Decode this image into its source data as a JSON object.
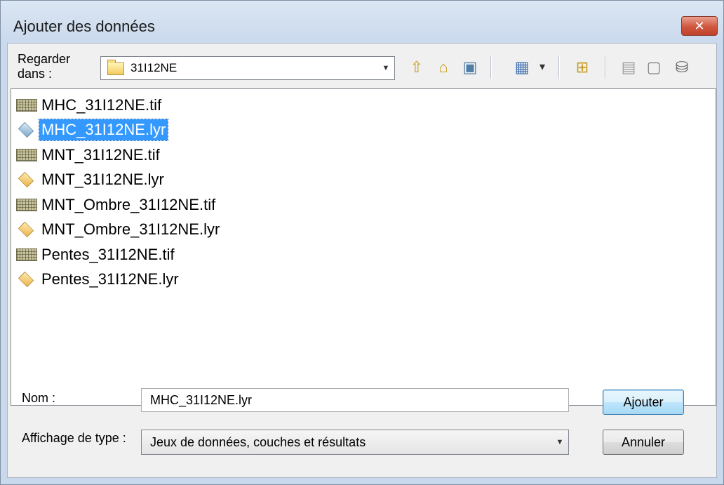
{
  "window": {
    "title": "Ajouter des données",
    "close_glyph": "✕"
  },
  "toolbar": {
    "look_in_label": "Regarder dans :",
    "look_in_value": "31I12NE",
    "buttons": [
      {
        "name": "up-one-level-icon",
        "glyph": "⇧",
        "color": "#c79a1b"
      },
      {
        "name": "home-icon",
        "glyph": "⌂",
        "color": "#c79a1b"
      },
      {
        "name": "catalog-connect-icon",
        "glyph": "▣",
        "color": "#4f7fa8"
      },
      {
        "name": "view-list-icon",
        "glyph": "▦",
        "color": "#3f6fb0"
      },
      {
        "name": "view-dropdown-icon",
        "glyph": "▾",
        "color": "#333333"
      },
      {
        "name": "new-folder-icon",
        "glyph": "⊞",
        "color": "#c79a1b"
      },
      {
        "name": "new-item-icon",
        "glyph": "▤",
        "color": "#9a9a9a"
      },
      {
        "name": "properties-icon",
        "glyph": "▢",
        "color": "#7f7f7f"
      },
      {
        "name": "connect-database-icon",
        "glyph": "⛁",
        "color": "#5f5f5f"
      }
    ]
  },
  "files": [
    {
      "name": "MHC_31I12NE.tif",
      "type": "raster",
      "selected": false
    },
    {
      "name": "MHC_31I12NE.lyr",
      "type": "layer-blue",
      "selected": true
    },
    {
      "name": "MNT_31I12NE.tif",
      "type": "raster",
      "selected": false
    },
    {
      "name": "MNT_31I12NE.lyr",
      "type": "layer",
      "selected": false
    },
    {
      "name": "MNT_Ombre_31I12NE.tif",
      "type": "raster",
      "selected": false
    },
    {
      "name": "MNT_Ombre_31I12NE.lyr",
      "type": "layer",
      "selected": false
    },
    {
      "name": "Pentes_31I12NE.tif",
      "type": "raster",
      "selected": false
    },
    {
      "name": "Pentes_31I12NE.lyr",
      "type": "layer",
      "selected": false
    }
  ],
  "form": {
    "name_label": "Nom :",
    "name_value": "MHC_31I12NE.lyr",
    "type_label": "Affichage de type :",
    "type_value": "Jeux de données, couches et résultats",
    "add_button": "Ajouter",
    "cancel_button": "Annuler"
  }
}
